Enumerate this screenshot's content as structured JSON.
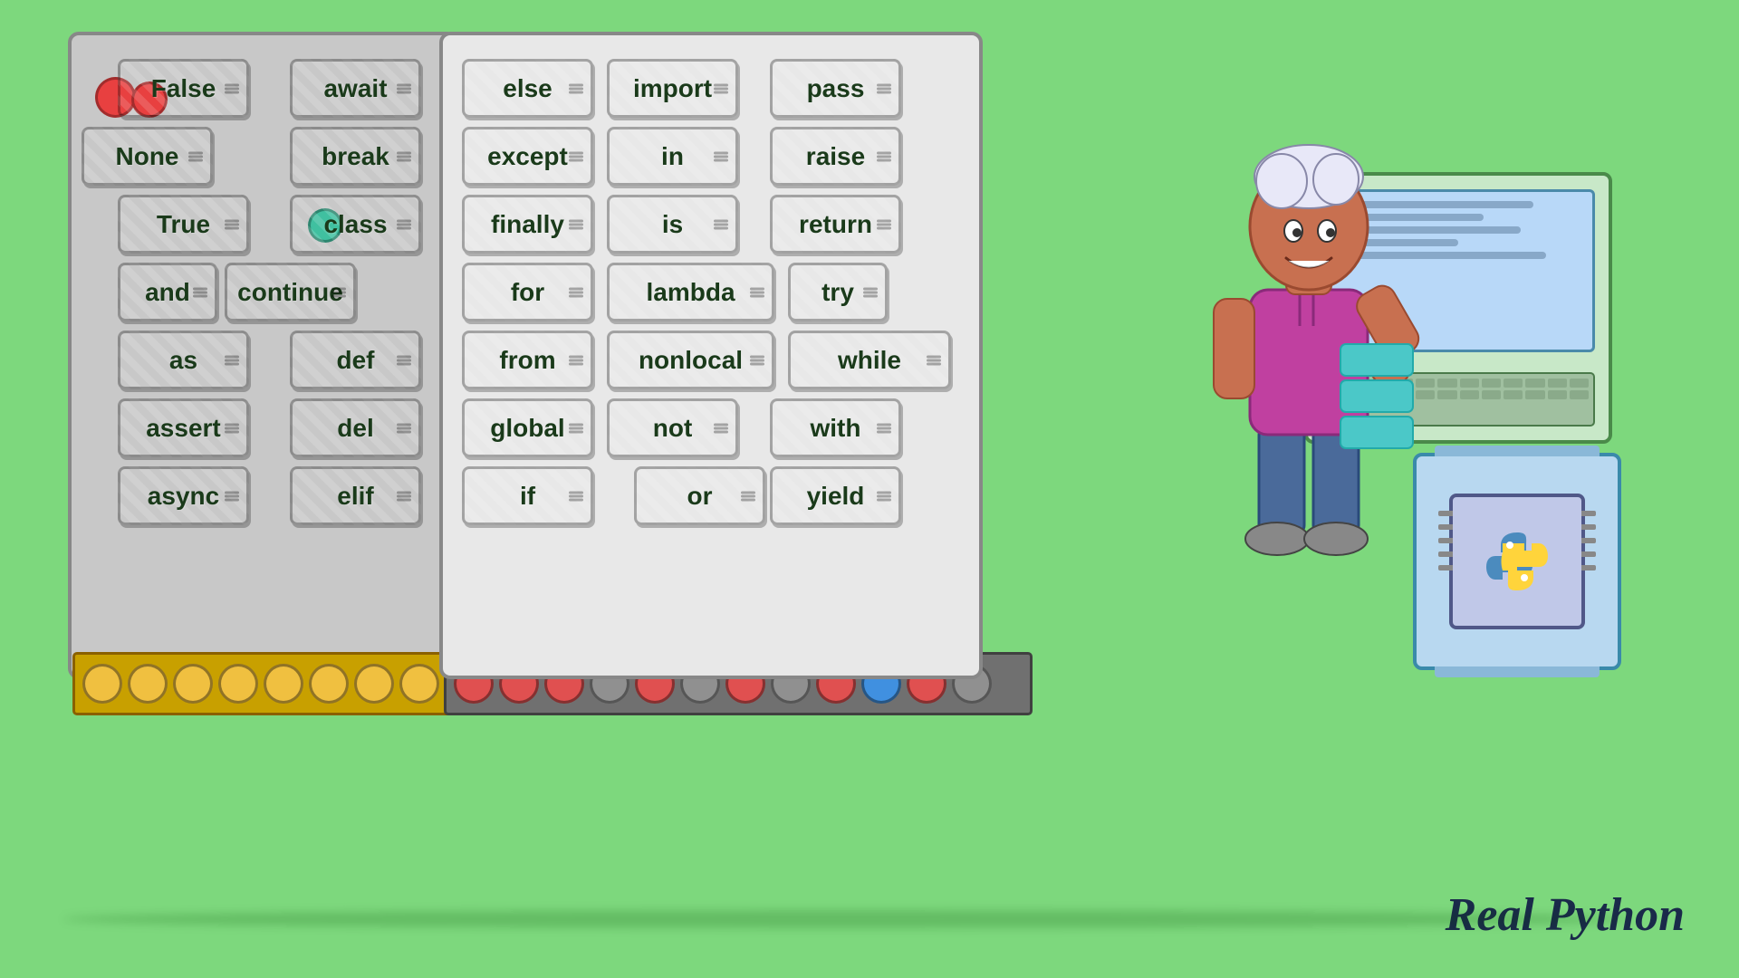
{
  "background": "#7dd87d",
  "brand": "Real Python",
  "keywords": {
    "left_col1": [
      "False",
      "None",
      "True",
      "and",
      "as",
      "assert",
      "async"
    ],
    "left_col2": [
      "await",
      "break",
      "class",
      "continue",
      "def",
      "del",
      "elif"
    ],
    "right_col1": [
      "else",
      "except",
      "finally",
      "for",
      "from",
      "global",
      "if"
    ],
    "right_col2": [
      "import",
      "in",
      "is",
      "lambda",
      "nonlocal",
      "not",
      "or"
    ],
    "right_col3": [
      "pass",
      "raise",
      "return",
      "try",
      "while",
      "with",
      "yield"
    ]
  },
  "colors": {
    "bg": "#7dd87d",
    "cabinet_fill": "#d8d8d8",
    "cabinet_border": "#777",
    "conveyor_yellow": "#c8a000",
    "conveyor_dark": "#606060"
  }
}
